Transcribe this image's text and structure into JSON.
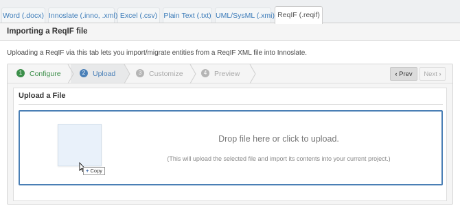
{
  "tabs": [
    {
      "label": "Word (.docx)"
    },
    {
      "label": "Innoslate (.inno, .xml)"
    },
    {
      "label": "Excel (.csv)"
    },
    {
      "label": "Plain Text (.txt)"
    },
    {
      "label": "UML/SysML (.xmi)"
    },
    {
      "label": "ReqIF (.reqif)"
    }
  ],
  "active_tab": "ReqIF (.reqif)",
  "header": {
    "title": "Importing a ReqIF file"
  },
  "description": "Uploading a ReqIF via this tab lets you import/migrate entities from a ReqIF XML file into Innoslate.",
  "wizard": {
    "steps": [
      {
        "num": "1",
        "label": "Configure",
        "state": "complete"
      },
      {
        "num": "2",
        "label": "Upload",
        "state": "current"
      },
      {
        "num": "3",
        "label": "Customize",
        "state": "pending"
      },
      {
        "num": "4",
        "label": "Preview",
        "state": "pending"
      }
    ],
    "prev_label": "Prev",
    "next_label": "Next"
  },
  "upload": {
    "title": "Upload a File",
    "drop_text": "Drop file here or click to upload.",
    "drop_subtext": "(This will upload the selected file and import its contents into your current project.)",
    "copy_badge_plus": "+",
    "copy_badge_label": "Copy"
  },
  "colors": {
    "link_blue": "#3a7ab8",
    "step_complete": "#3c8f4a",
    "step_current": "#4a80b8",
    "dropzone_border": "#4a7fb5"
  }
}
